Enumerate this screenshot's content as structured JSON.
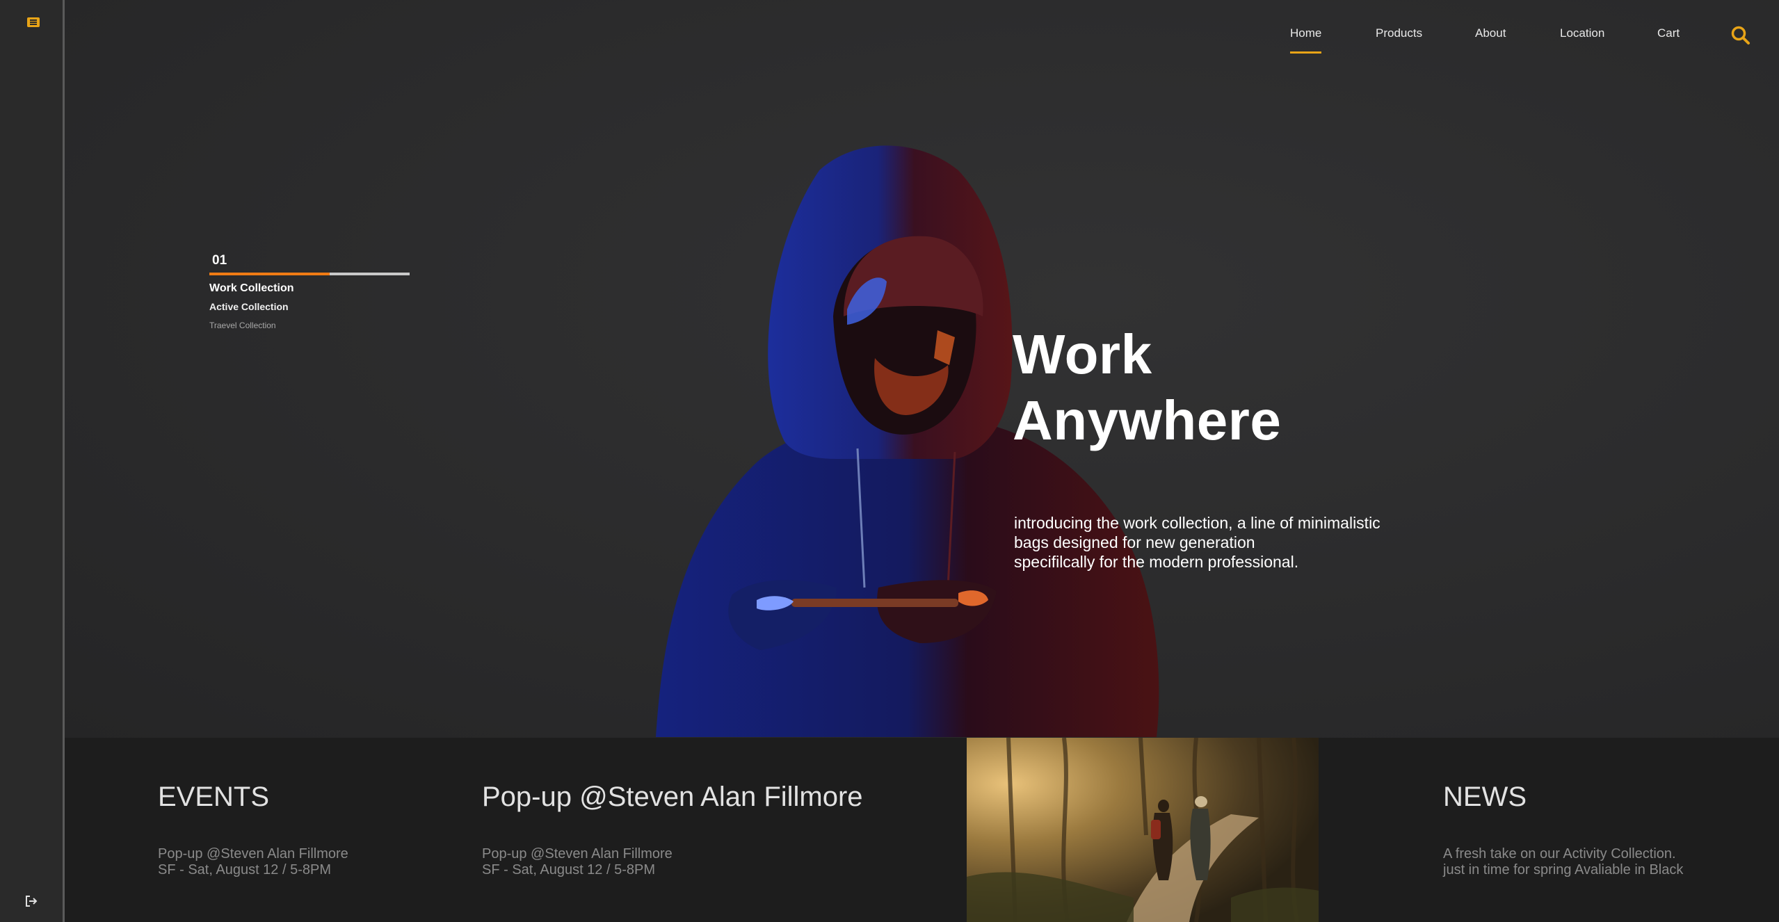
{
  "colors": {
    "accent": "#e8a417",
    "progress": "#f07b14",
    "background": "#2b2b2c",
    "strip": "#1d1d1d"
  },
  "rail": {
    "menu_icon": "menu-icon",
    "exit_icon": "sign-out-icon"
  },
  "nav": {
    "items": [
      {
        "label": "Home",
        "active": true
      },
      {
        "label": "Products",
        "active": false
      },
      {
        "label": "About",
        "active": false
      },
      {
        "label": "Location",
        "active": false
      },
      {
        "label": "Cart",
        "active": false
      }
    ],
    "search_icon": "search-icon"
  },
  "collections": {
    "number": "01",
    "progress": 0.6,
    "items": [
      {
        "label": "Work Collection",
        "active": true
      },
      {
        "label": "Active Collection",
        "active": false
      },
      {
        "label": "Traevel Collection",
        "active": false
      }
    ]
  },
  "hero": {
    "headline_line1": "Work",
    "headline_line2": "Anywhere",
    "intro_lines": [
      "introducing the work collection, a line of minimalistic",
      "bags designed for new generation",
      "specifilcally for the modern professional."
    ]
  },
  "events": {
    "title": "EVENTS",
    "lines": [
      "Pop-up @Steven Alan Fillmore",
      "SF - Sat, August 12 / 5-8PM"
    ]
  },
  "popup": {
    "title": "Pop-up @Steven Alan Fillmore",
    "lines": [
      "Pop-up @Steven Alan Fillmore",
      "SF - Sat, August 12 / 5-8PM"
    ]
  },
  "news": {
    "title": "NEWS",
    "lines": [
      "A fresh take on our Activity Collection.",
      "just in time for spring Avaliable in Black"
    ]
  }
}
